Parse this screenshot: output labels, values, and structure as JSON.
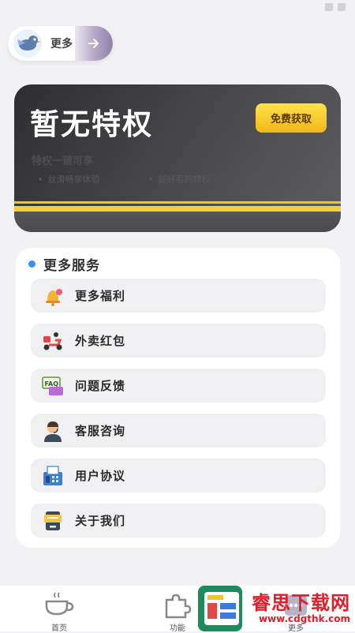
{
  "top_pill": {
    "label": "更多"
  },
  "card": {
    "title": "暂无特权",
    "claim_label": "免费获取",
    "subtitle": "特权一键可享",
    "benefits": [
      "丝滑畅享体验",
      "超好看的特权"
    ]
  },
  "services": {
    "header": "更多服务",
    "items": [
      {
        "label": "更多福利",
        "icon": "bell-gift-icon"
      },
      {
        "label": "外卖红包",
        "icon": "delivery-scooter-icon"
      },
      {
        "label": "问题反馈",
        "icon": "faq-icon"
      },
      {
        "label": "客服咨询",
        "icon": "customer-service-icon"
      },
      {
        "label": "用户协议",
        "icon": "fax-document-icon"
      },
      {
        "label": "关于我们",
        "icon": "info-board-icon"
      }
    ]
  },
  "nav": {
    "items": [
      {
        "label": "首页",
        "icon": "coffee-cup-icon"
      },
      {
        "label": "功能",
        "icon": "puzzle-icon"
      },
      {
        "label": "更多",
        "icon": "more-icon"
      }
    ]
  },
  "watermark": {
    "title": "睿思下载网",
    "url": "www.cdgthk.com"
  },
  "colors": {
    "accent": "#3d8ef5",
    "claim_button": "#f5c623",
    "card_dark": "#3b3b3d",
    "watermark": "#e11d2a"
  }
}
